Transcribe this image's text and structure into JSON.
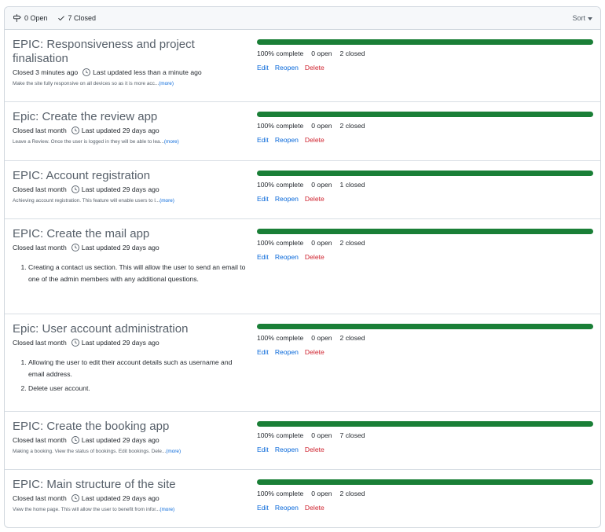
{
  "header": {
    "open_label": "0 Open",
    "closed_label": "7 Closed",
    "sort_label": "Sort"
  },
  "milestones": [
    {
      "title": "EPIC: Responsiveness and project finalisation",
      "closed": "Closed 3 minutes ago",
      "updated": "Last updated less than a minute ago",
      "description": "Make the site fully responsive on all devices so as it is more acc...",
      "more": "(more)",
      "complete": "100% complete",
      "open": "0 open",
      "closed_count": "2 closed",
      "edit": "Edit",
      "reopen": "Reopen",
      "delete": "Delete"
    },
    {
      "title": "Epic: Create the review app",
      "closed": "Closed last month",
      "updated": "Last updated 29 days ago",
      "description": "Leave a Review. Once the user is logged in they will be able to lea...",
      "more": "(more)",
      "complete": "100% complete",
      "open": "0 open",
      "closed_count": "2 closed",
      "edit": "Edit",
      "reopen": "Reopen",
      "delete": "Delete"
    },
    {
      "title": "EPIC: Account registration",
      "closed": "Closed last month",
      "updated": "Last updated 29 days ago",
      "description": "Achieving account registration. This feature will enable users to l...",
      "more": "(more)",
      "complete": "100% complete",
      "open": "0 open",
      "closed_count": "1 closed",
      "edit": "Edit",
      "reopen": "Reopen",
      "delete": "Delete"
    },
    {
      "title": "EPIC: Create the mail app",
      "closed": "Closed last month",
      "updated": "Last updated 29 days ago",
      "list": [
        "Creating a contact us section. This will allow the user to send an email to one of the admin members with any additional questions."
      ],
      "complete": "100% complete",
      "open": "0 open",
      "closed_count": "2 closed",
      "edit": "Edit",
      "reopen": "Reopen",
      "delete": "Delete"
    },
    {
      "title": "Epic: User account administration",
      "closed": "Closed last month",
      "updated": "Last updated 29 days ago",
      "list": [
        "Allowing the user to edit their account details such as username and email address.",
        "Delete user account."
      ],
      "complete": "100% complete",
      "open": "0 open",
      "closed_count": "2 closed",
      "edit": "Edit",
      "reopen": "Reopen",
      "delete": "Delete"
    },
    {
      "title": "EPIC: Create the booking app",
      "closed": "Closed last month",
      "updated": "Last updated 29 days ago",
      "description": "Making a booking. View the status of bookings. Edit bookings. Dele...",
      "more": "(more)",
      "complete": "100% complete",
      "open": "0 open",
      "closed_count": "7 closed",
      "edit": "Edit",
      "reopen": "Reopen",
      "delete": "Delete"
    },
    {
      "title": "EPIC: Main structure of the site",
      "closed": "Closed last month",
      "updated": "Last updated 29 days ago",
      "description": "View the home page. This will allow the user to benefit from infor...",
      "more": "(more)",
      "complete": "100% complete",
      "open": "0 open",
      "closed_count": "2 closed",
      "edit": "Edit",
      "reopen": "Reopen",
      "delete": "Delete"
    }
  ]
}
